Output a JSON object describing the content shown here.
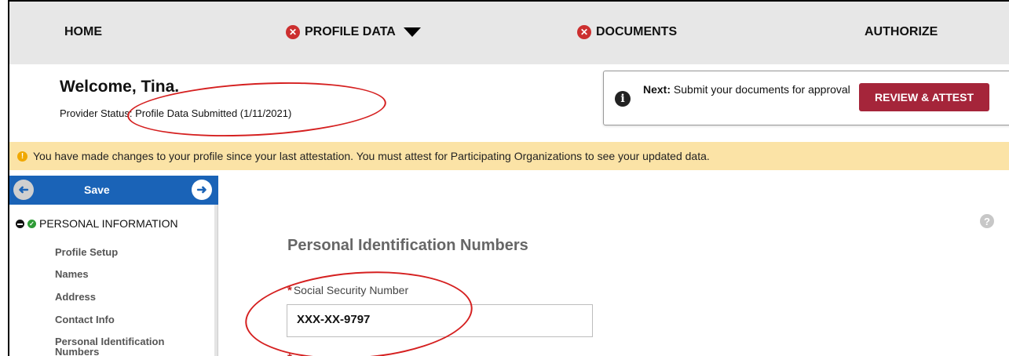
{
  "nav": {
    "home": "HOME",
    "profile_data": "PROFILE DATA",
    "documents": "DOCUMENTS",
    "authorize": "AUTHORIZE"
  },
  "welcome": {
    "title": "Welcome, Tina.",
    "status_label": "Provider Status:",
    "status_value": "Profile Data Submitted (1/11/2021)"
  },
  "next_panel": {
    "lead": "Next:",
    "text": "Submit your documents for approval",
    "button": "REVIEW & ATTEST"
  },
  "warning": {
    "text": "You have made changes to your profile since your last attestation. You must attest for Participating Organizations to see your updated data."
  },
  "sidebar": {
    "save_label": "Save",
    "section": "PERSONAL INFORMATION",
    "items": [
      "Profile Setup",
      "Names",
      "Address",
      "Contact Info",
      "Personal Identification Numbers"
    ]
  },
  "main": {
    "section_title": "Personal Identification Numbers",
    "ssn_label": "Social Security Number",
    "ssn_value": "XXX-XX-9797",
    "required_mark": "*"
  },
  "colors": {
    "nav_bg": "#e7e7e7",
    "error_badge": "#cc2f2f",
    "review_button": "#a5253a",
    "warning_bg": "#fbe3a6",
    "save_bar": "#1a63b7",
    "annotation_red": "#d52020"
  },
  "icons": [
    "error-x-icon",
    "dropdown-caret-icon",
    "info-icon",
    "warning-icon",
    "back-arrow-icon",
    "forward-arrow-icon",
    "collapse-minus-icon",
    "complete-check-icon",
    "help-icon"
  ]
}
